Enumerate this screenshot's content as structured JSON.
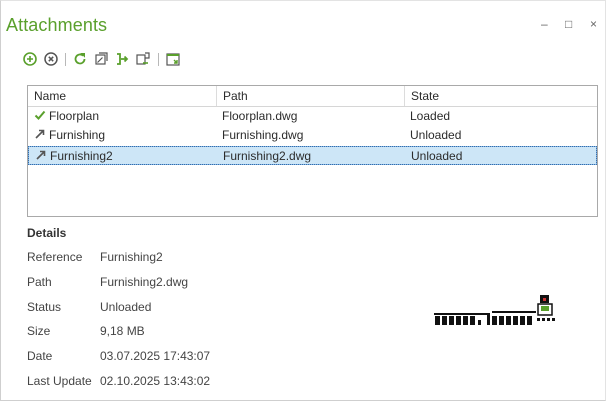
{
  "window": {
    "title": "Attachments",
    "minimize_glyph": "–",
    "maximize_glyph": "□",
    "close_glyph": "×"
  },
  "toolbar": {
    "buttons": [
      {
        "icon": "add-circle-icon"
      },
      {
        "icon": "remove-circle-icon"
      },
      {
        "icon": "reload-icon"
      },
      {
        "icon": "unload-icon"
      },
      {
        "icon": "bind-icon"
      },
      {
        "icon": "detach-icon"
      },
      {
        "icon": "open-drawing-icon"
      }
    ],
    "accent": "#5aa02c"
  },
  "grid": {
    "columns": [
      "Name",
      "Path",
      "State"
    ],
    "rows": [
      {
        "name": "Floorplan",
        "path": "Floorplan.dwg",
        "state": "Loaded",
        "icon": "check-icon",
        "selected": false
      },
      {
        "name": "Furnishing",
        "path": "Furnishing.dwg",
        "state": "Unloaded",
        "icon": "unloaded-arrow-icon",
        "selected": false
      },
      {
        "name": "Furnishing2",
        "path": "Furnishing2.dwg",
        "state": "Unloaded",
        "icon": "unloaded-arrow-icon",
        "selected": true
      }
    ],
    "selection_color": "#cde6f7"
  },
  "details": {
    "heading": "Details",
    "fields": [
      {
        "label": "Reference",
        "value": "Furnishing2"
      },
      {
        "label": "Path",
        "value": "Furnishing2.dwg"
      },
      {
        "label": "Status",
        "value": "Unloaded"
      },
      {
        "label": "Size",
        "value": "9,18 MB"
      },
      {
        "label": "Date",
        "value": "03.07.2025 17:43:07"
      },
      {
        "label": "Last Update",
        "value": "02.10.2025 13:43:02"
      }
    ]
  }
}
